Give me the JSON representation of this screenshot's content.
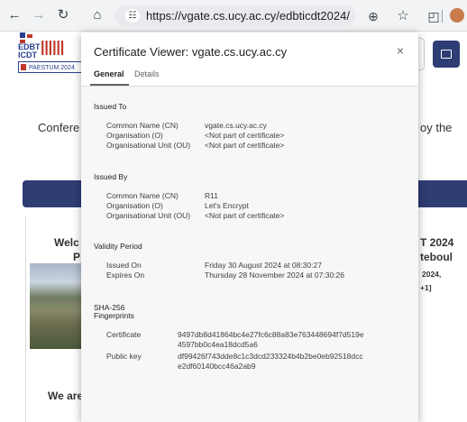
{
  "browser": {
    "url": "https://vgate.cs.ucy.ac.cy/edbticdt2024/",
    "icons": {
      "back": "back-arrow-icon",
      "forward": "forward-arrow-icon",
      "reload": "reload-icon",
      "home": "home-icon",
      "site_info": "site-settings-icon",
      "zoom": "zoom-icon",
      "bookmark": "star-icon",
      "extensions": "extensions-icon"
    }
  },
  "page": {
    "logo": {
      "line1": "EDBT",
      "line2": "ICDT",
      "badge": "PAESTUM 2024"
    },
    "conference_left": "Confere",
    "conference_right": "oy the",
    "welcome_left": "Welc",
    "p_fragment": "P",
    "we_are": "We are",
    "right_t2024": "T 2024",
    "right_teboul": "teboul",
    "right_year": "2024,",
    "right_bracket": "+1]",
    "accent_color": "#2f3d75"
  },
  "dialog": {
    "title": "Certificate Viewer: vgate.cs.ucy.ac.cy",
    "close_label": "×",
    "tabs": [
      "General",
      "Details"
    ],
    "active_tab": "General",
    "issued_to": {
      "heading": "Issued To",
      "rows": [
        {
          "label": "Common Name (CN)",
          "value": "vgate.cs.ucy.ac.cy"
        },
        {
          "label": "Organisation (O)",
          "value": "<Not part of certificate>"
        },
        {
          "label": "Organisational Unit (OU)",
          "value": "<Not part of certificate>"
        }
      ]
    },
    "issued_by": {
      "heading": "Issued By",
      "rows": [
        {
          "label": "Common Name (CN)",
          "value": "R11"
        },
        {
          "label": "Organisation (O)",
          "value": "Let's Encrypt"
        },
        {
          "label": "Organisational Unit (OU)",
          "value": "<Not part of certificate>"
        }
      ]
    },
    "validity": {
      "heading": "Validity Period",
      "rows": [
        {
          "label": "Issued On",
          "value": "Friday 30 August 2024 at 08:30:27"
        },
        {
          "label": "Expires On",
          "value": "Thursday 28 November 2024 at 07:30:26"
        }
      ]
    },
    "fingerprints": {
      "heading_line1": "SHA-256",
      "heading_line2": "Fingerprints",
      "rows": [
        {
          "label": "Certificate",
          "value": "9497db8d41864bc4e27fc6c88a83e763448694f7d519e4597bb0c4ea18dcd5a6"
        },
        {
          "label": "Public key",
          "value": "df99426f743dde8c1c3dcd233324b4b2be0eb92518dcce2df60140bcc46a2ab9"
        }
      ]
    }
  }
}
